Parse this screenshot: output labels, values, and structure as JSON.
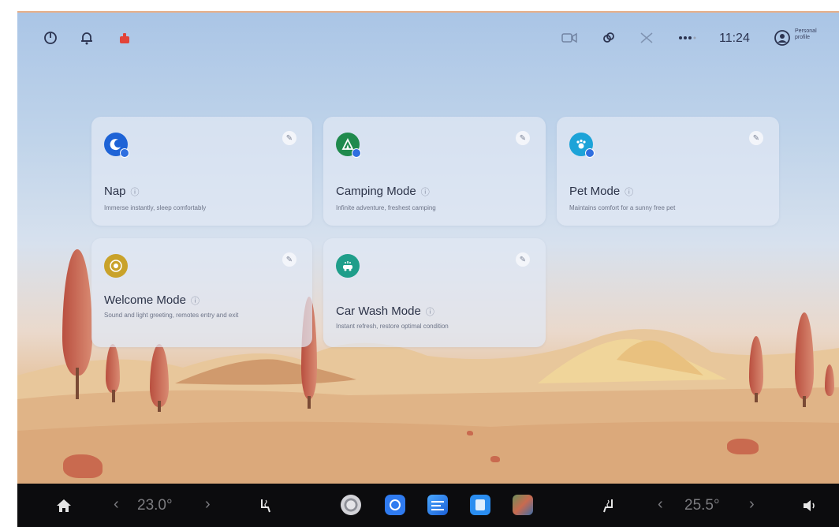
{
  "status_bar": {
    "time": "11:24",
    "profile_line1": "Personal",
    "profile_line2": "profile"
  },
  "cards": [
    {
      "title": "Nap",
      "desc": "Immerse instantly, sleep comfortably",
      "icon": "nap-icon",
      "color": "#1e63d6"
    },
    {
      "title": "Camping Mode",
      "desc": "Infinite adventure, freshest camping",
      "icon": "camping-icon",
      "color": "#1f8a4d"
    },
    {
      "title": "Pet Mode",
      "desc": "Maintains comfort for a sunny free pet",
      "icon": "pet-icon",
      "color": "#1ca3d8"
    },
    {
      "title": "Welcome Mode",
      "desc": "Sound and light greeting, remotes entry and exit",
      "icon": "welcome-icon",
      "color": "#c9a22a"
    },
    {
      "title": "Car Wash Mode",
      "desc": "Instant refresh, restore optimal condition",
      "icon": "car-wash-icon",
      "color": "#1f9e8a"
    }
  ],
  "dock": {
    "temp_left": "23.0°",
    "temp_right": "25.5°"
  }
}
